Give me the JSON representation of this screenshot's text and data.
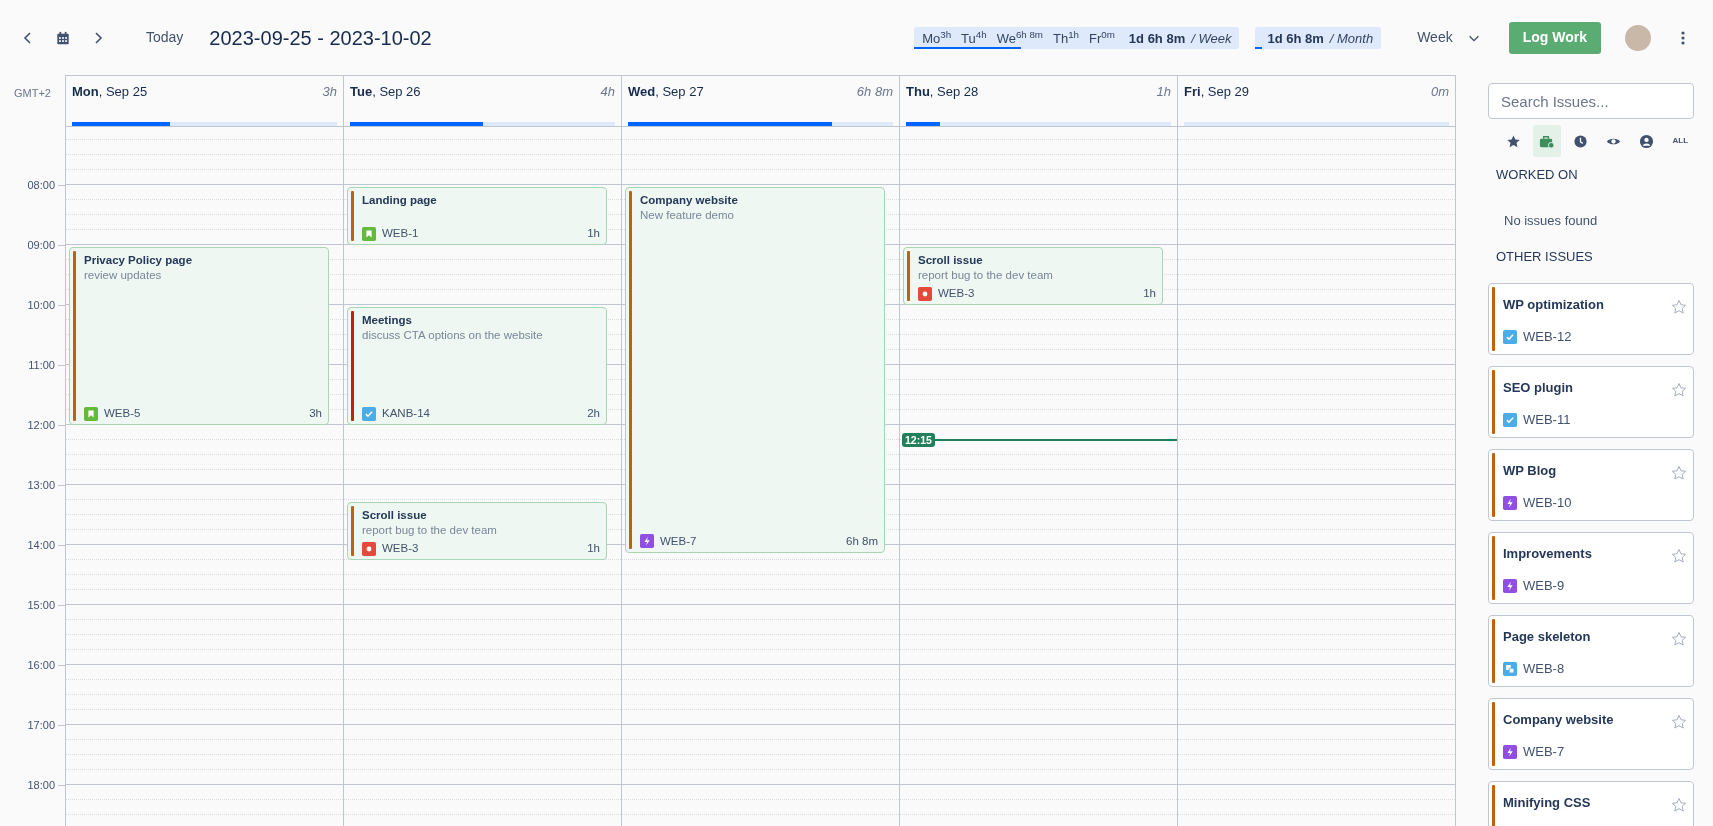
{
  "toolbar": {
    "today": "Today",
    "range": "2023-09-25 - 2023-10-02",
    "week_summary": {
      "days": [
        {
          "label": "Mo$^{3h}$"
        },
        {
          "label": "Tu$^{4h}$"
        },
        {
          "label": "We$^{6h 8m}$"
        },
        {
          "label": "Th$^{1h}$"
        },
        {
          "label": "Fr$^{0m}$"
        }
      ],
      "total": "1d 6h 8m",
      "period": "/ Week",
      "level": 0.33
    },
    "month_summary": {
      "total": "1d 6h 8m",
      "period": "/ Month",
      "level": 0.05
    },
    "view": "Week",
    "log_button": "Log Work"
  },
  "calendar": {
    "timezone": "GMT+2",
    "hours": [
      "08:00",
      "09:00",
      "10:00",
      "11:00",
      "12:00",
      "13:00",
      "14:00",
      "15:00",
      "16:00",
      "17:00",
      "18:00"
    ],
    "days": [
      {
        "label": "**Mon**, Sep 25",
        "total": "3h",
        "level": 0.37,
        "events": [
          {
            "title": "Privacy Policy page",
            "description": "review updates",
            "kind": "story",
            "key": "WEB-5",
            "duration": "3h",
            "color": "#c2610c"
          }
        ]
      },
      {
        "label": "**Tue**, Sep 26",
        "total": "4h",
        "level": 0.5,
        "events": [
          {
            "title": "Landing page",
            "kind": "story",
            "key": "WEB-1",
            "duration": "1h",
            "color": "#c2610c"
          },
          {
            "title": "Meetings",
            "description": "discuss CTA options on the website",
            "kind": "task",
            "key": "KANB-14",
            "duration": "2h",
            "color": "#bf2600"
          },
          {
            "title": "Scroll issue",
            "description": "report bug to the dev team",
            "kind": "bug",
            "key": "WEB-3",
            "duration": "1h",
            "color": "#c2610c"
          }
        ]
      },
      {
        "label": "**Wed**, Sep 27",
        "total": "6h 8m",
        "level": 0.77,
        "events": [
          {
            "title": "Company website",
            "description": "New feature demo",
            "kind": "epic",
            "key": "WEB-7",
            "duration": "6h 8m",
            "color": "#c2610c"
          }
        ]
      },
      {
        "label": "**Thu**, Sep 28",
        "total": "1h",
        "level": 0.13,
        "events": [
          {
            "title": "Scroll issue",
            "description": "report bug to the dev team",
            "kind": "bug",
            "key": "WEB-3",
            "duration": "1h",
            "color": "#c2610c"
          }
        ],
        "now": {
          "label": "12:15"
        }
      },
      {
        "label": "**Fri**, Sep 29",
        "total": "0m",
        "level": 0
      }
    ]
  },
  "sidebar": {
    "search": {
      "placeholder": "Search Issues..."
    },
    "filters": [
      {
        "kind": "star",
        "selected": false
      },
      {
        "kind": "briefcase",
        "selected": true
      },
      {
        "kind": "clock",
        "selected": false
      },
      {
        "kind": "eye",
        "selected": false
      },
      {
        "kind": "user",
        "selected": false
      },
      {
        "kind": "all",
        "label": "ALL",
        "selected": false
      }
    ],
    "worked_on": {
      "heading": "WORKED ON",
      "empty": "No issues found"
    },
    "other": {
      "heading": "OTHER ISSUES",
      "issues": [
        {
          "title": "WP optimization",
          "kind": "task",
          "key": "WEB-12"
        },
        {
          "title": "SEO plugin",
          "kind": "task",
          "key": "WEB-11"
        },
        {
          "title": "WP Blog",
          "kind": "epic",
          "key": "WEB-10"
        },
        {
          "title": "Improvements",
          "kind": "epic",
          "key": "WEB-9"
        },
        {
          "title": "Page skeleton",
          "kind": "subtask",
          "key": "WEB-8"
        },
        {
          "title": "Company website",
          "kind": "epic",
          "key": "WEB-7"
        },
        {
          "title": "Minifying CSS"
        }
      ]
    }
  }
}
